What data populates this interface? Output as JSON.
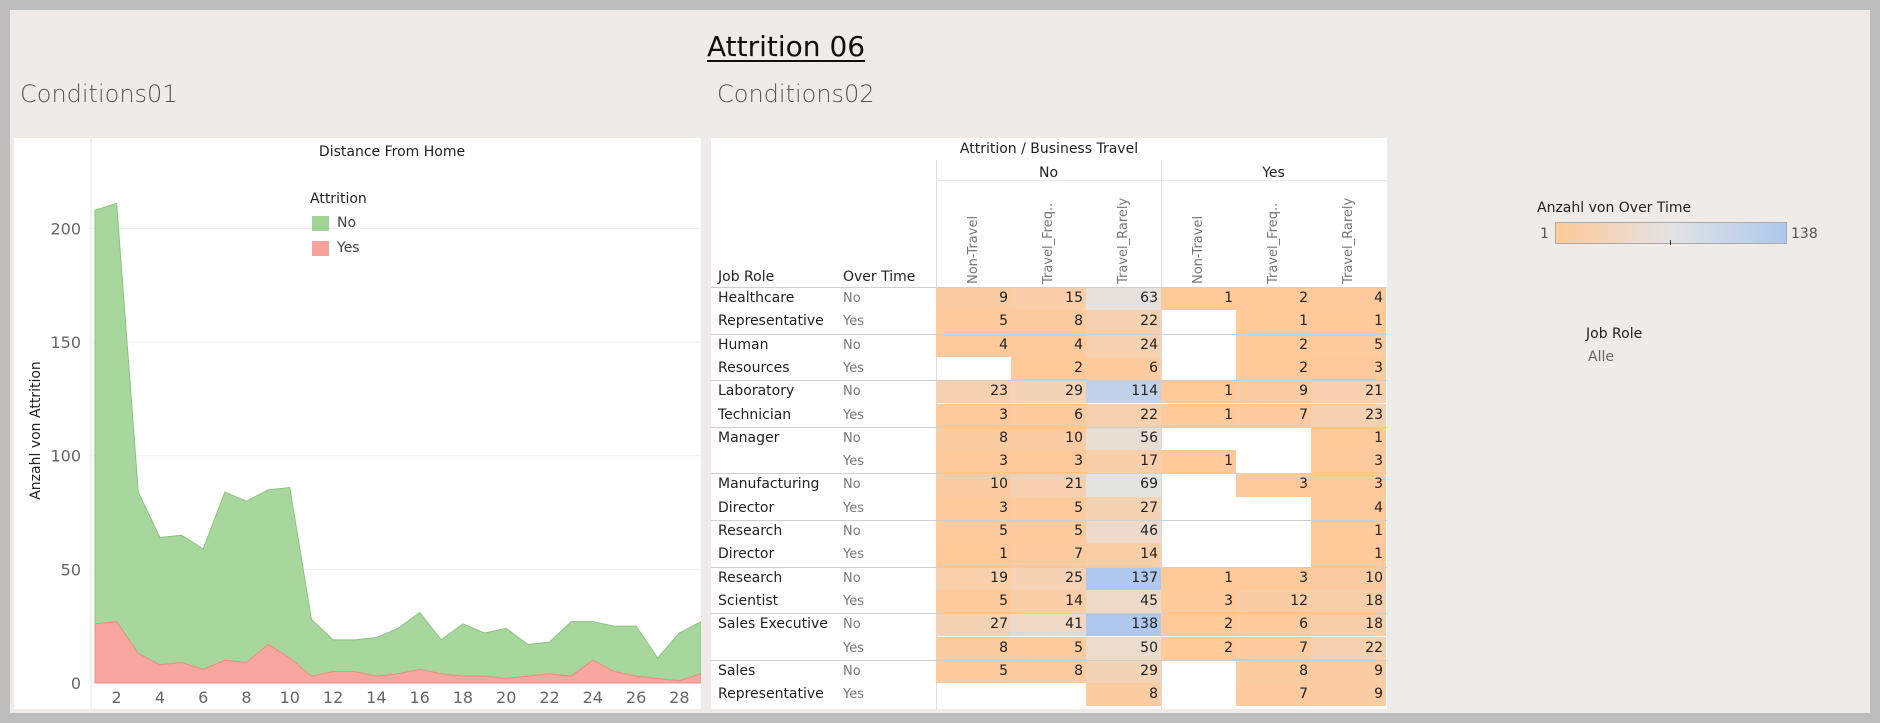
{
  "dashboard": {
    "title": "Attrition 06"
  },
  "sheets": {
    "left_title": "Conditions01",
    "right_title": "Conditions02"
  },
  "area_chart": {
    "header": "Distance From Home",
    "legend_title": "Attrition",
    "legend_items": [
      {
        "label": "No",
        "color": "#9ed394"
      },
      {
        "label": "Yes",
        "color": "#f7a29b"
      }
    ]
  },
  "crosstab": {
    "header": "Attrition  /  Business Travel",
    "row_header_role": "Job Role",
    "row_header_ot": "Over Time",
    "attrition_groups": [
      "No",
      "Yes"
    ],
    "travel_columns": [
      "Non-Travel",
      "Travel_Freq..",
      "Travel_Rarely",
      "Non-Travel",
      "Travel_Freq..",
      "Travel_Rarely"
    ],
    "roles": [
      {
        "line1": "Healthcare",
        "line2": "Representative"
      },
      {
        "line1": "Human",
        "line2": "Resources"
      },
      {
        "line1": "Laboratory",
        "line2": "Technician"
      },
      {
        "line1": "Manager",
        "line2": ""
      },
      {
        "line1": "Manufacturing",
        "line2": "Director"
      },
      {
        "line1": "Research",
        "line2": "Director"
      },
      {
        "line1": "Research",
        "line2": "Scientist"
      },
      {
        "line1": "Sales Executive",
        "line2": ""
      },
      {
        "line1": "Sales",
        "line2": "Representative"
      }
    ],
    "ot_values": [
      "No",
      "Yes"
    ],
    "rows": [
      [
        9,
        15,
        63,
        1,
        2,
        4
      ],
      [
        5,
        8,
        22,
        null,
        1,
        1
      ],
      [
        4,
        4,
        24,
        null,
        2,
        5
      ],
      [
        null,
        2,
        6,
        null,
        2,
        3
      ],
      [
        23,
        29,
        114,
        1,
        9,
        21
      ],
      [
        3,
        6,
        22,
        1,
        7,
        23
      ],
      [
        8,
        10,
        56,
        null,
        null,
        1
      ],
      [
        3,
        3,
        17,
        1,
        null,
        3
      ],
      [
        10,
        21,
        69,
        null,
        3,
        3
      ],
      [
        3,
        5,
        27,
        null,
        null,
        4
      ],
      [
        5,
        5,
        46,
        null,
        null,
        1
      ],
      [
        1,
        7,
        14,
        null,
        null,
        1
      ],
      [
        19,
        25,
        137,
        1,
        3,
        10
      ],
      [
        5,
        14,
        45,
        3,
        12,
        18
      ],
      [
        27,
        41,
        138,
        2,
        6,
        18
      ],
      [
        8,
        5,
        50,
        2,
        7,
        22
      ],
      [
        5,
        8,
        29,
        null,
        8,
        9
      ],
      [
        null,
        null,
        8,
        null,
        7,
        9
      ]
    ],
    "color_min": 1,
    "color_max": 138,
    "color_low": "#ffc999",
    "color_mid": "#e3e3e3",
    "color_high": "#aec8ee"
  },
  "color_legend": {
    "title": "Anzahl von Over Time",
    "min_label": "1",
    "max_label": "138"
  },
  "filter": {
    "title": "Job Role",
    "value": "Alle"
  },
  "chart_data": {
    "type": "area",
    "xlabel": "",
    "ylabel": "Anzahl von Attrition",
    "ylim": [
      0,
      220
    ],
    "xlim": [
      1,
      29
    ],
    "yticks": [
      0,
      50,
      100,
      150,
      200
    ],
    "xticks": [
      2,
      4,
      6,
      8,
      10,
      12,
      14,
      16,
      18,
      20,
      22,
      24,
      26,
      28
    ],
    "stacked": true,
    "x": [
      1,
      2,
      3,
      4,
      5,
      6,
      7,
      8,
      9,
      10,
      11,
      12,
      13,
      14,
      15,
      16,
      17,
      18,
      19,
      20,
      21,
      22,
      23,
      24,
      25,
      26,
      27,
      28,
      29
    ],
    "series": [
      {
        "name": "Yes",
        "color": "#f7a29b",
        "values": [
          26,
          27,
          13,
          8,
          9,
          6,
          10,
          9,
          17,
          11,
          3,
          5,
          5,
          3,
          4,
          6,
          4,
          3,
          3,
          2,
          3,
          4,
          3,
          10,
          5,
          3,
          2,
          1,
          4
        ]
      },
      {
        "name": "No",
        "color": "#9ed394",
        "values": [
          182,
          184,
          71,
          56,
          56,
          53,
          74,
          71,
          68,
          75,
          25,
          14,
          14,
          17,
          20,
          25,
          15,
          23,
          19,
          22,
          14,
          14,
          24,
          17,
          20,
          22,
          9,
          21,
          23
        ]
      }
    ]
  }
}
